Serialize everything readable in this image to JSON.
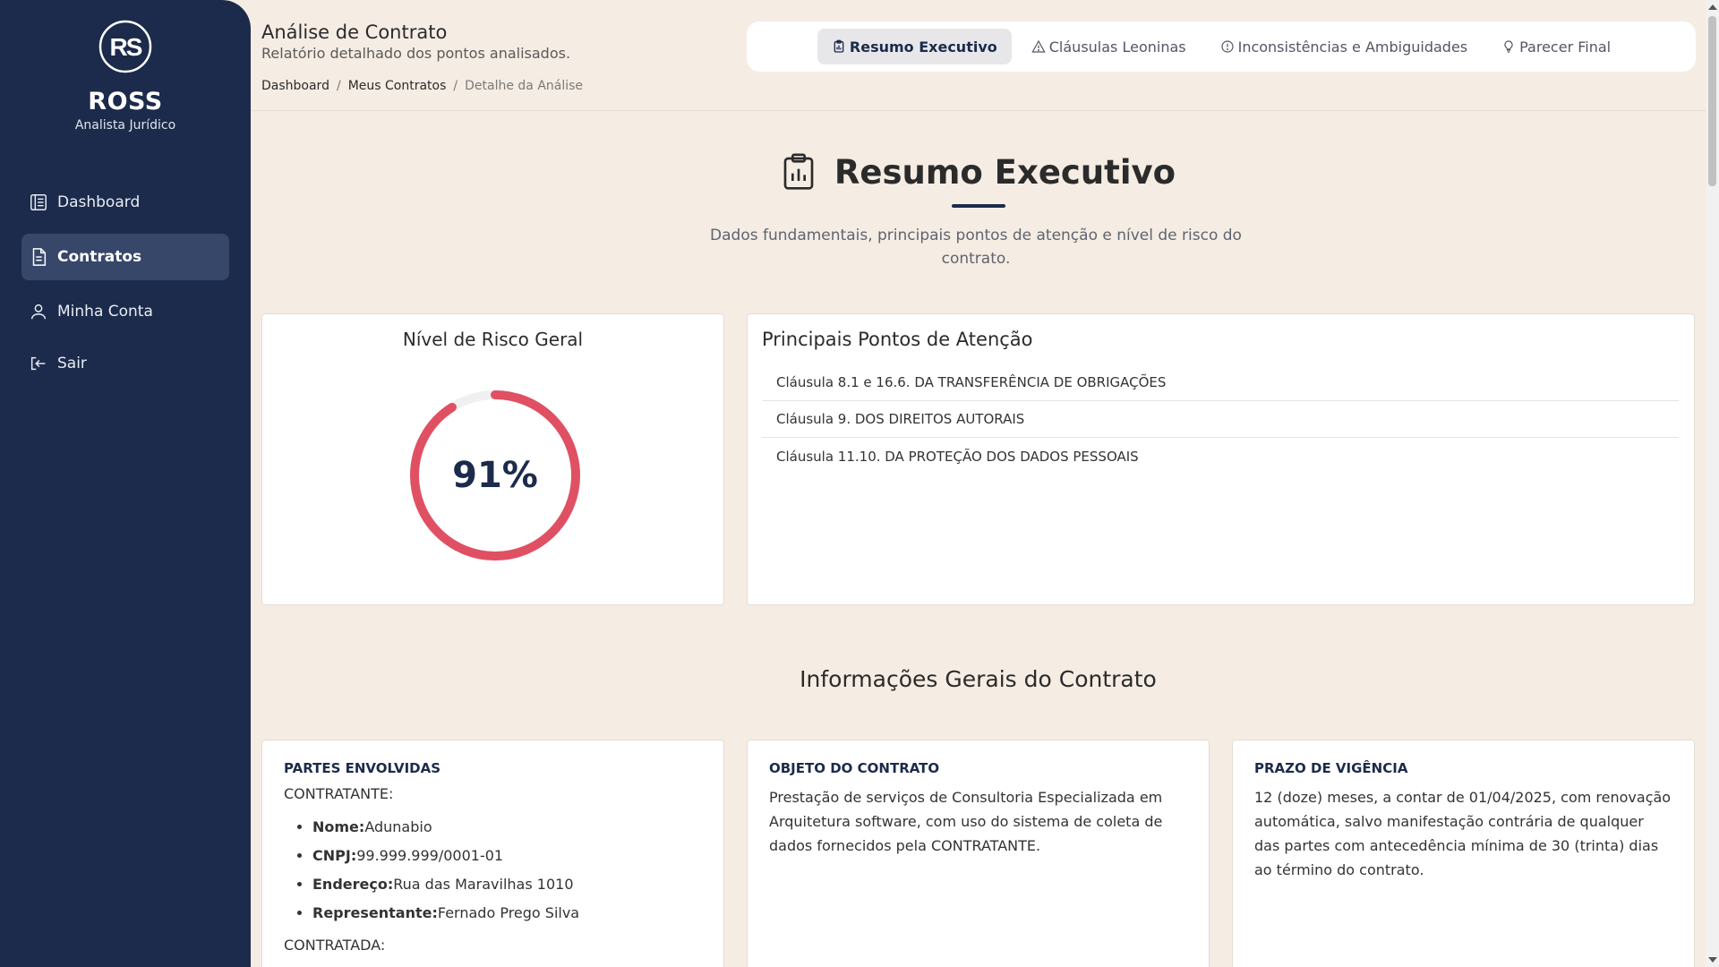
{
  "sidebar": {
    "brand_name": "ROSS",
    "brand_role": "Analista Jurídico",
    "items": [
      {
        "label": "Dashboard",
        "icon": "dashboard-icon"
      },
      {
        "label": "Contratos",
        "icon": "document-icon",
        "active": true
      },
      {
        "label": "Minha Conta",
        "icon": "user-icon"
      },
      {
        "label": "Sair",
        "icon": "logout-icon"
      }
    ]
  },
  "header": {
    "title": "Análise de Contrato",
    "subtitle": "Relatório detalhado dos pontos analisados.",
    "breadcrumb": [
      "Dashboard",
      "Meus Contratos",
      "Detalhe da Análise"
    ],
    "tabs": [
      {
        "label": "Resumo Executivo",
        "icon": "clipboard-chart-icon",
        "active": true
      },
      {
        "label": "Cláusulas Leoninas",
        "icon": "warning-icon"
      },
      {
        "label": "Inconsistências e Ambiguidades",
        "icon": "info-circle-icon"
      },
      {
        "label": "Parecer Final",
        "icon": "lightbulb-icon"
      }
    ]
  },
  "summary": {
    "title": "Resumo Executivo",
    "description": "Dados fundamentais, principais pontos de atenção e nível de risco do contrato."
  },
  "risk": {
    "title": "Nível de Risco Geral",
    "value_label": "91%",
    "value": 0.91,
    "color": "#e05063",
    "track_color": "#f0f0f0"
  },
  "attention_points": {
    "title": "Principais Pontos de Atenção",
    "items": [
      "Cláusula 8.1 e 16.6. DA TRANSFERÊNCIA DE OBRIGAÇÕES",
      "Cláusula 9. DOS DIREITOS AUTORAIS",
      "Cláusula 11.10. DA PROTEÇÃO DOS DADOS PESSOAIS"
    ]
  },
  "general_info": {
    "title": "Informações Gerais do Contrato",
    "parties": {
      "heading": "PARTES ENVOLVIDAS",
      "contratante_label": "CONTRATANTE:",
      "fields": [
        {
          "key": "Nome:",
          "value": "Adunabio"
        },
        {
          "key": "CNPJ:",
          "value": "99.999.999/0001-01"
        },
        {
          "key": "Endereço:",
          "value": "Rua das Maravilhas 1010"
        },
        {
          "key": "Representante:",
          "value": "Fernado Prego Silva"
        }
      ],
      "contratada_label": "CONTRATADA:"
    },
    "object": {
      "heading": "OBJETO DO CONTRATO",
      "text": "Prestação de serviços de Consultoria Especializada em Arquitetura software, com uso do sistema de coleta de dados fornecidos pela CONTRATANTE."
    },
    "term": {
      "heading": "PRAZO DE VIGÊNCIA",
      "text": "12 (doze) meses, a contar de 01/04/2025, com renovação automática, salvo manifestação contrária de qualquer das partes com antecedência mínima de 30 (trinta) dias ao término do contrato."
    }
  }
}
